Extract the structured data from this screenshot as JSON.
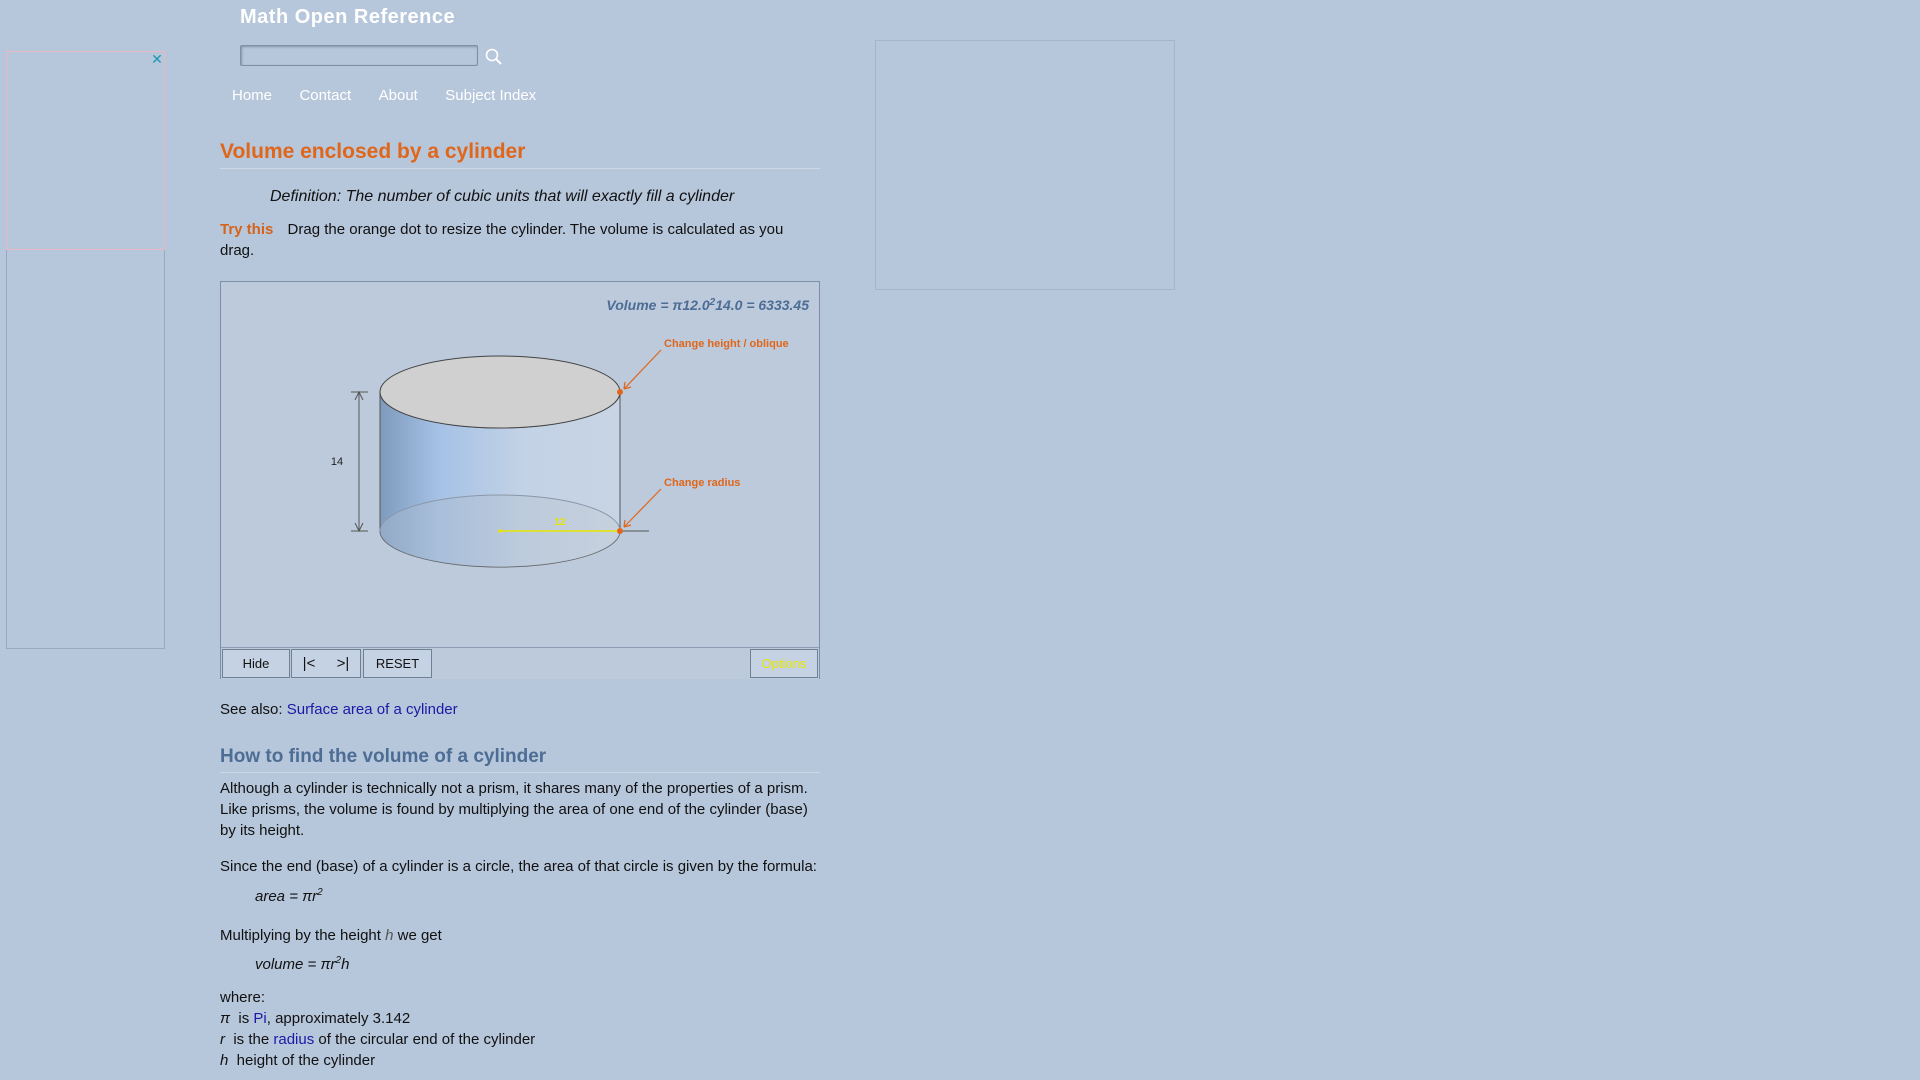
{
  "header": {
    "site_title": "Math Open Reference",
    "search_placeholder": ""
  },
  "nav": [
    "Home",
    "Contact",
    "About",
    "Subject Index"
  ],
  "page": {
    "title": "Volume enclosed by a cylinder",
    "definition": "Definition: The number of cubic units that will exactly fill a cylinder",
    "try_label": "Try this",
    "try_text": "Drag the orange dot to resize the cylinder. The volume is calculated as you drag."
  },
  "applet": {
    "volume_prefix": "Volume = π",
    "volume_radius": "12.0",
    "volume_sup": "2",
    "volume_rest": "14.0 = 6333.45",
    "label_height": "Change height / oblique",
    "label_radius": "Change radius",
    "dim_height": "14",
    "dim_radius": "12",
    "buttons": {
      "hide": "Hide",
      "first": "|<",
      "next": ">|",
      "reset": "RESET",
      "options": "Options"
    },
    "colors": {
      "accent": "#e0661a",
      "options_text": "#e6e600",
      "radius_line": "#e6e600"
    }
  },
  "see_also": {
    "prefix": "See also: ",
    "link": "Surface area of a cylinder"
  },
  "section": {
    "title": "How to find the volume of a cylinder",
    "para1": "Although a cylinder is technically not a prism, it shares many of the properties of a prism. Like prisms, the volume is found by multiplying the area of one end of the cylinder (base) by its height.",
    "para2": "Since the end (base) of a cylinder is a circle, the area of that circle is given by the formula:",
    "formula1_text": "area = πr",
    "formula1_sup": "2",
    "para3_prefix": "Multiplying by the height ",
    "para3_var": "h",
    "para3_suffix": " we get",
    "formula2_text": "volume = πr",
    "formula2_sup": "2",
    "formula2_tail": "h",
    "where": "where:",
    "defs": [
      {
        "sym": "π",
        "pre": "  is ",
        "link": "Pi",
        "post": ", approximately 3.142"
      },
      {
        "sym": "r",
        "pre": "  is the ",
        "link": "radius",
        "post": " of the circular end of the cylinder"
      },
      {
        "sym": "h",
        "pre": "  height of the cylinder",
        "link": "",
        "post": ""
      }
    ]
  }
}
